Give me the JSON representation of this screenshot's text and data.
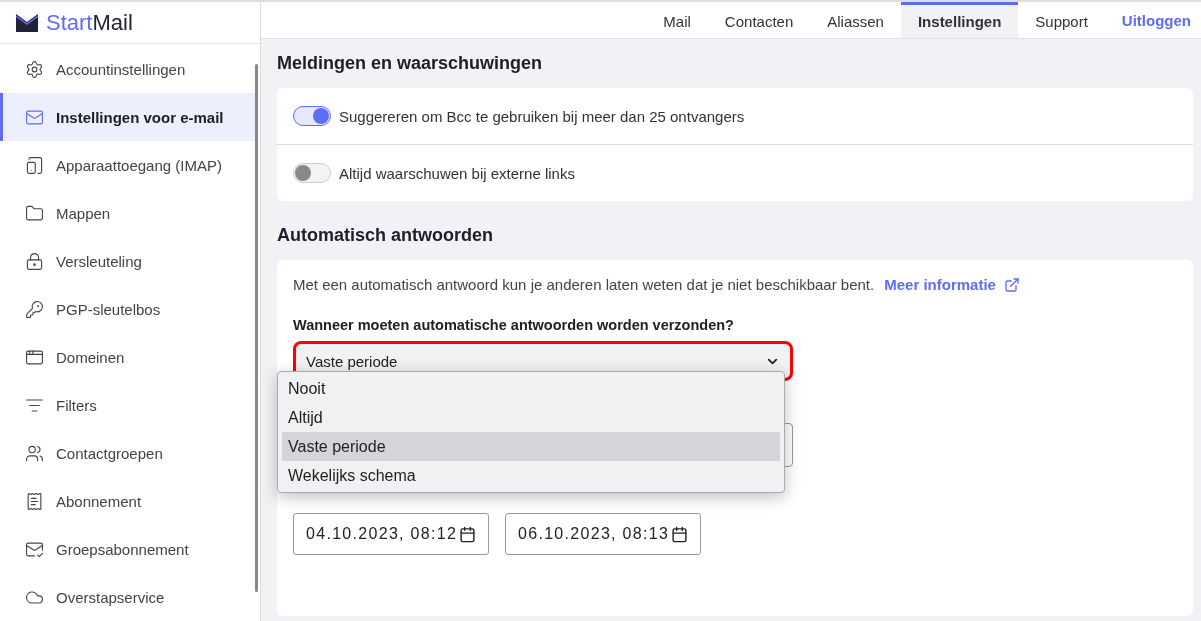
{
  "logo": {
    "part_1": "Start",
    "part_2": "Mail"
  },
  "nav": {
    "tabs": [
      {
        "label": "Mail",
        "selected": false
      },
      {
        "label": "Contacten",
        "selected": false
      },
      {
        "label": "Aliassen",
        "selected": false
      },
      {
        "label": "Instellingen",
        "selected": true
      },
      {
        "label": "Support",
        "selected": false
      }
    ],
    "logout": "Uitloggen"
  },
  "sidebar": {
    "items": [
      {
        "label": "Accountinstellingen",
        "selected": false
      },
      {
        "label": "Instellingen voor e-mail",
        "selected": true
      },
      {
        "label": "Apparaattoegang (IMAP)",
        "selected": false
      },
      {
        "label": "Mappen",
        "selected": false
      },
      {
        "label": "Versleuteling",
        "selected": false
      },
      {
        "label": "PGP-sleutelbos",
        "selected": false
      },
      {
        "label": "Domeinen",
        "selected": false
      },
      {
        "label": "Filters",
        "selected": false
      },
      {
        "label": "Contactgroepen",
        "selected": false
      },
      {
        "label": "Abonnement",
        "selected": false
      },
      {
        "label": "Groepsabonnement",
        "selected": false
      },
      {
        "label": "Overstapservice",
        "selected": false
      }
    ]
  },
  "notifications": {
    "title": "Meldingen en waarschuwingen",
    "toggles": [
      {
        "label": "Suggereren om Bcc te gebruiken bij meer dan 25 ontvangers",
        "on": true
      },
      {
        "label": "Altijd waarschuwen bij externe links",
        "on": false
      }
    ]
  },
  "auto_reply": {
    "title": "Automatisch antwoorden",
    "description": "Met een automatisch antwoord kun je anderen laten weten dat je niet beschikbaar bent.",
    "link": "Meer informatie",
    "question": "Wanneer moeten automatische antwoorden worden verzonden?",
    "select": {
      "value": "Vaste periode",
      "highlighted": true,
      "expanded": true,
      "options": [
        {
          "label": "Nooit",
          "selected": false
        },
        {
          "label": "Altijd",
          "selected": false
        },
        {
          "label": "Vaste periode",
          "selected": true
        },
        {
          "label": "Wekelijks schema",
          "selected": false
        }
      ]
    },
    "dates": [
      "04.10.2023, 08:12",
      "06.10.2023, 08:13"
    ]
  }
}
